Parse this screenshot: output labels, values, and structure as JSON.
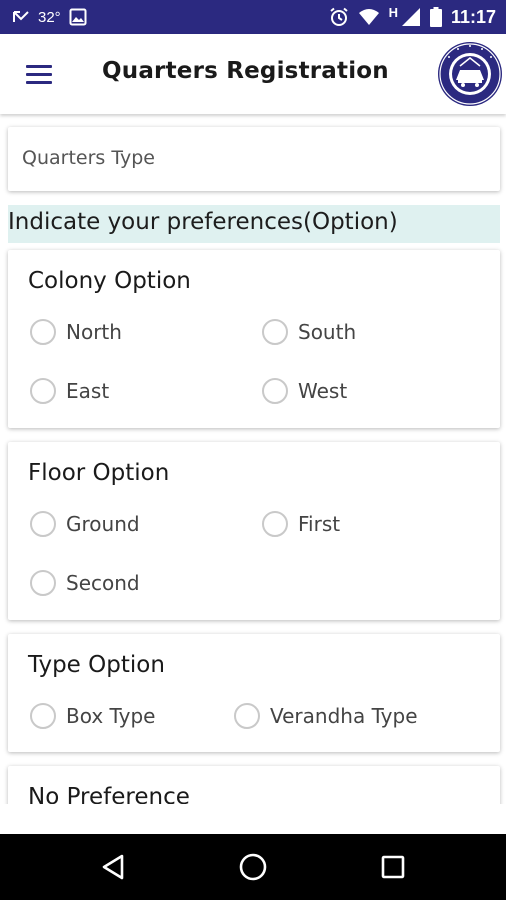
{
  "status_bar": {
    "temperature": "32°",
    "time": "11:17",
    "network_label": "H",
    "icons": [
      "call-missed-icon",
      "image-icon",
      "alarm-icon",
      "wifi-icon",
      "signal-icon",
      "battery-icon"
    ]
  },
  "app_bar": {
    "title": "Quarters Registration",
    "menu_icon": "hamburger-menu-icon",
    "logo": "indian-railways-logo"
  },
  "form": {
    "quarters_type": {
      "value": "",
      "placeholder": "Quarters Type"
    },
    "preferences_heading": "Indicate your preferences(Option)",
    "colony_option": {
      "title": "Colony Option",
      "options": [
        "North",
        "South",
        "East",
        "West"
      ]
    },
    "floor_option": {
      "title": "Floor Option",
      "options": [
        "Ground",
        "First",
        "Second"
      ]
    },
    "type_option": {
      "title": "Type Option",
      "options": [
        "Box Type",
        "Verandha Type"
      ]
    },
    "no_preference": {
      "title": "No Preference"
    }
  },
  "colors": {
    "brand": "#2b2980",
    "banner_bg": "#dff1f0",
    "radio_border": "#c9c9c9"
  }
}
